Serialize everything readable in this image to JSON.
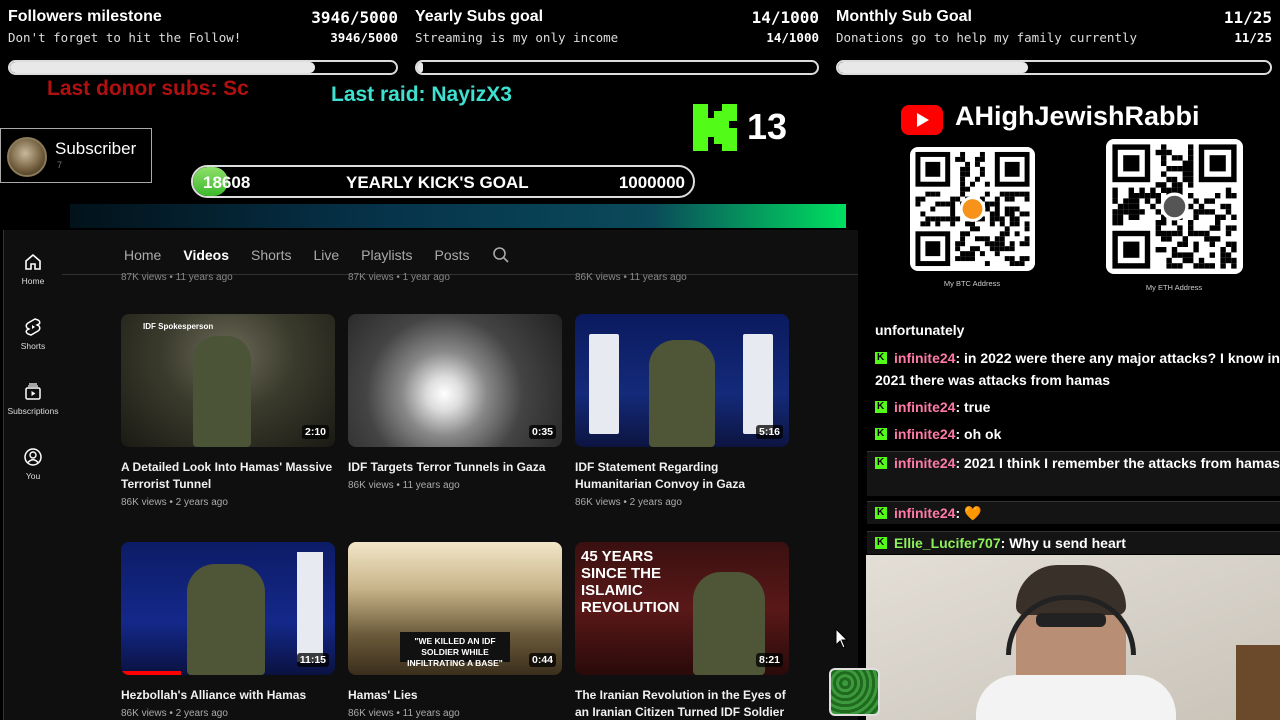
{
  "goals": [
    {
      "title": "Followers milestone",
      "count": "3946/5000",
      "subtitle": "Don't forget to hit the Follow!",
      "count2": "3946/5000",
      "progress": 0.789
    },
    {
      "title": "Yearly Subs goal",
      "count": "14/1000",
      "subtitle": "Streaming is my only income",
      "count2": "14/1000",
      "progress": 0.014
    },
    {
      "title": "Monthly Sub Goal",
      "count": "11/25",
      "subtitle": "Donations go to help my family currently",
      "count2": "11/25",
      "progress": 0.44
    }
  ],
  "tickers": {
    "donor": "Last donor subs: Sc",
    "raid": "Last raid: NayizX3"
  },
  "subscriber_card": {
    "label": "Subscriber",
    "count": "7"
  },
  "kick": {
    "count": "13"
  },
  "kick_goal": {
    "current": "18608",
    "label": "YEARLY KICK'S GOAL",
    "target": "1000000",
    "progress": 0.0186
  },
  "youtube": {
    "sidebar": [
      {
        "label": "Home",
        "icon": "home-icon"
      },
      {
        "label": "Shorts",
        "icon": "shorts-icon"
      },
      {
        "label": "Subscriptions",
        "icon": "subscriptions-icon"
      },
      {
        "label": "You",
        "icon": "you-icon"
      }
    ],
    "tabs": [
      "Home",
      "Videos",
      "Shorts",
      "Live",
      "Playlists",
      "Posts"
    ],
    "active_tab": "Videos",
    "previous_row_meta": [
      "87K views • 11 years ago",
      "87K views • 1 year ago",
      "86K views • 11 years ago"
    ],
    "videos": [
      {
        "title": "A Detailed Look Into Hamas' Massive Terrorist Tunnel",
        "meta": "86K views • 2 years ago",
        "duration": "2:10",
        "overlay": "IDF Spokesperson"
      },
      {
        "title": "IDF Targets Terror Tunnels in Gaza",
        "meta": "86K views • 11 years ago",
        "duration": "0:35",
        "overlay": ""
      },
      {
        "title": "IDF Statement Regarding Humanitarian Convoy in Gaza",
        "meta": "86K views • 2 years ago",
        "duration": "5:16",
        "overlay": ""
      },
      {
        "title": "Hezbollah's Alliance with Hamas",
        "meta": "86K views • 2 years ago",
        "duration": "11:15",
        "overlay": ""
      },
      {
        "title": "Hamas' Lies",
        "meta": "86K views • 11 years ago",
        "duration": "0:44",
        "overlay": "\"WE KILLED AN IDF SOLDIER WHILE INFILTRATING A BASE\""
      },
      {
        "title": "The Iranian Revolution in the Eyes of an Iranian Citizen Turned IDF Soldier",
        "meta": "",
        "duration": "8:21",
        "overlay": "45 YEARS SINCE THE ISLAMIC REVOLUTION"
      }
    ]
  },
  "channel": {
    "name": "AHighJewishRabbi",
    "qr_btc": "My BTC Address",
    "qr_eth": "My ETH Address"
  },
  "chat": [
    {
      "user": "",
      "text": "unfortunately"
    },
    {
      "user": "infinite24",
      "text": ": in 2022 were there any major attacks? I know in 2021 there was attacks from hamas"
    },
    {
      "user": "infinite24",
      "text": ": true"
    },
    {
      "user": "infinite24",
      "text": ": oh ok"
    },
    {
      "user": "infinite24",
      "text": ": 2021 I think I remember the attacks from hamas"
    },
    {
      "user": "infinite24",
      "text": ": 🧡"
    },
    {
      "user": "Ellie_Lucifer707",
      "text": ": Why u send heart"
    }
  ],
  "colors": {
    "kick_green": "#53fc18",
    "youtube_red": "#ff0000",
    "donor_red": "#b01010",
    "raid_cyan": "#3ee0d0",
    "chat_user": "#ff7aa8"
  }
}
